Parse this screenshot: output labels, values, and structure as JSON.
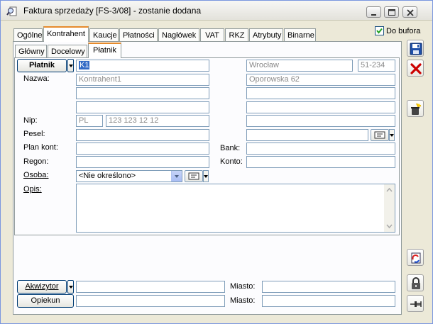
{
  "window": {
    "title": "Faktura sprzedaży [FS-3/08]  - zostanie dodana"
  },
  "main_tabs": [
    "Ogólne",
    "Kontrahent",
    "Kaucje",
    "Płatności",
    "Nagłówek",
    "VAT",
    "RKZ",
    "Atrybuty",
    "Binarne"
  ],
  "active_main_tab": "Kontrahent",
  "sub_tabs": [
    "Główny",
    "Docelowy",
    "Płatnik"
  ],
  "active_sub_tab": "Płatnik",
  "do_bufora": {
    "label": "Do bufora",
    "checked": true
  },
  "platnik": {
    "button_label": "Płatnik",
    "code": "K1",
    "labels": {
      "nazwa": "Nazwa:",
      "nip": "Nip:",
      "pesel": "Pesel:",
      "plan_kont": "Plan kont:",
      "regon": "Regon:",
      "osoba": "Osoba:",
      "opis": "Opis:",
      "bank": "Bank:",
      "konto": "Konto:"
    },
    "nazwa_lines": [
      "Kontrahent1",
      "",
      ""
    ],
    "nip_prefix": "PL",
    "nip": "123 123 12 12",
    "pesel": "",
    "plan_kont": "",
    "regon": "",
    "osoba": "<Nie określono>",
    "opis": "",
    "city": "Wrocław",
    "postal_code": "51-234",
    "street": "Oporowska 62",
    "address_lines": [
      "",
      "",
      ""
    ],
    "bank": "",
    "konto": ""
  },
  "bottom": {
    "akwizytor_label": "Akwizytor",
    "opiekun_label": "Opiekun",
    "miasto_label": "Miasto:",
    "akwizytor_value": "",
    "akwizytor_city": "",
    "opiekun_value": "",
    "opiekun_city": ""
  },
  "icons": {
    "title": "magnifier-document-icon",
    "save": "floppy-disk-icon",
    "cancel": "red-x-icon",
    "wizard": "trash-magic-icon",
    "refresh": "document-refresh-icon",
    "lock": "padlock-icon",
    "pin": "pushpin-icon"
  },
  "colors": {
    "accent_tab": "#e68b2c",
    "selection": "#316ac5",
    "cancel_red": "#cc0000"
  }
}
